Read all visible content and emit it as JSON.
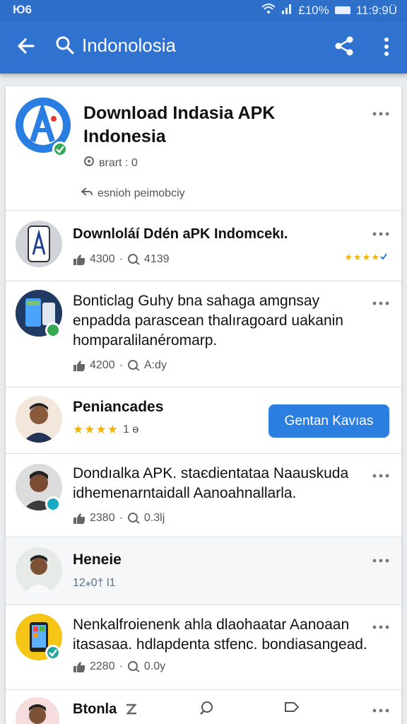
{
  "status_bar": {
    "left": "Ю6",
    "battery": "£10%",
    "time": "11:9:9Ü"
  },
  "app_bar": {
    "query": "Indonolosia"
  },
  "header": {
    "title": "Download Indasia APK Indonesia",
    "meta": "вrart : 0",
    "actions": "esnioh  peimobciy"
  },
  "results": [
    {
      "title": "Downloláí Ddén aPK Indomcekı.",
      "likes": "4300",
      "comments": "4139",
      "rating_stars": "★★★★"
    },
    {
      "title": "Bonticlag Guhy",
      "body": "Bonticlag Guhy bna sahaga amgnsay enpadda parascean thalıragoard uakanin homparalilanéromarp.",
      "likes": "4200",
      "comments": "A:dy"
    },
    {
      "title": "Peniancades",
      "rating_stars": "★★★★",
      "rating_value": "1 ɵ",
      "button": "Gentan Kavıas"
    },
    {
      "title": "Dondıalka APK. staєdientataa Naauskuda idhemenarntaidall Aanoahnallarla.",
      "likes": "2380",
      "comments": "0.3lj"
    },
    {
      "title": "Heneie",
      "meta": "12⁎0†  l1"
    },
    {
      "title": "Nenkalfroienenk ahla dlaohaatar Aanoaan itasasaa. hdlapdenta stfenc. bondiasangead.",
      "likes": "2280",
      "comments": "0.0y"
    },
    {
      "title": "Btonla"
    }
  ],
  "colors": {
    "appbar": "#2f72cf",
    "accent_button": "#2c7fe0",
    "star": "#f4b400"
  }
}
